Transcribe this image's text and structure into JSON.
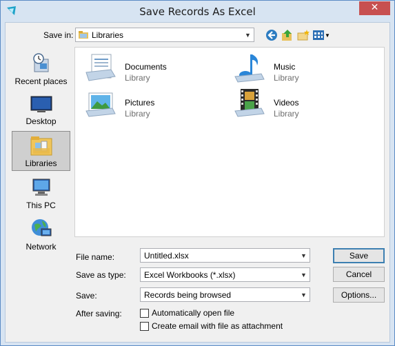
{
  "window": {
    "title": "Save Records As Excel",
    "close_glyph": "✕"
  },
  "save_in": {
    "label": "Save in:",
    "value": "Libraries"
  },
  "toolbar": {
    "icons": [
      "back-icon",
      "up-folder-icon",
      "new-folder-icon",
      "view-menu-icon"
    ]
  },
  "places": [
    {
      "label": "Recent places",
      "icon": "recent-places-icon"
    },
    {
      "label": "Desktop",
      "icon": "desktop-icon"
    },
    {
      "label": "Libraries",
      "icon": "libraries-icon",
      "selected": true
    },
    {
      "label": "This PC",
      "icon": "this-pc-icon"
    },
    {
      "label": "Network",
      "icon": "network-icon"
    }
  ],
  "libraries": [
    {
      "name": "Documents",
      "sub": "Library",
      "icon": "documents-library-icon"
    },
    {
      "name": "Music",
      "sub": "Library",
      "icon": "music-library-icon"
    },
    {
      "name": "Pictures",
      "sub": "Library",
      "icon": "pictures-library-icon"
    },
    {
      "name": "Videos",
      "sub": "Library",
      "icon": "videos-library-icon"
    }
  ],
  "form": {
    "file_name_label": "File name:",
    "file_name_value": "Untitled.xlsx",
    "save_type_label": "Save as type:",
    "save_type_value": "Excel Workbooks (*.xlsx)",
    "save_label": "Save:",
    "save_value": "Records being browsed",
    "after_saving_label": "After saving:",
    "checkbox_open": "Automatically open file",
    "checkbox_email": "Create email with file as attachment"
  },
  "buttons": {
    "save": "Save",
    "cancel": "Cancel",
    "options": "Options..."
  },
  "colors": {
    "close_red": "#c75050",
    "frame_blue": "#d7e4f2",
    "accent_blue": "#3c7fb1"
  }
}
